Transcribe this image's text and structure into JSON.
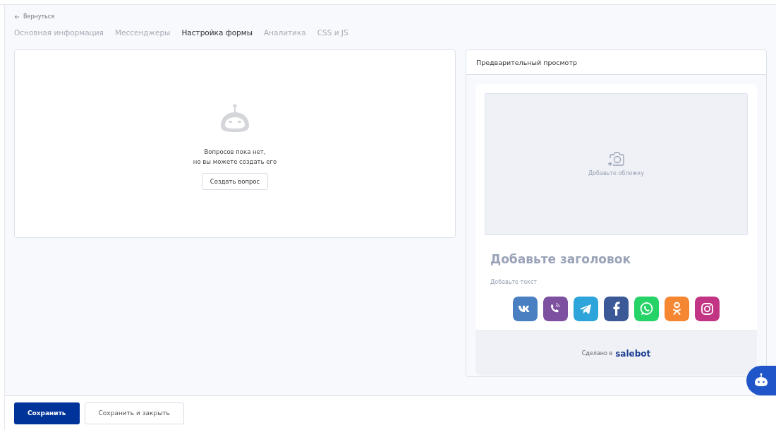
{
  "back_link": "Вернуться",
  "tabs": [
    {
      "label": "Основная информация",
      "selected": false
    },
    {
      "label": "Мессенджеры",
      "selected": false
    },
    {
      "label": "Настройка формы",
      "selected": true
    },
    {
      "label": "Аналитика",
      "selected": false
    },
    {
      "label": "CSS и JS",
      "selected": false
    }
  ],
  "questions": {
    "empty_text": [
      "Вопросов пока нет,",
      "но вы можете создать его"
    ],
    "create_button": "Создать вопрос"
  },
  "preview": {
    "title": "Предварительный просмотр",
    "cover_hint": "Добавьте обложку",
    "heading": "Добавьте заголовок",
    "text": "Добавьте текст",
    "messengers": [
      {
        "kind": "vk",
        "color": "#4a7fc1"
      },
      {
        "kind": "viber",
        "color": "#7d50a0"
      },
      {
        "kind": "telegram",
        "color": "#2ea5da"
      },
      {
        "kind": "facebook",
        "color": "#3b5897"
      },
      {
        "kind": "whatsapp",
        "color": "#25d366"
      },
      {
        "kind": "ok",
        "color": "#f58732"
      },
      {
        "kind": "instagram",
        "color": "#c13584"
      }
    ],
    "footer_text": "Сделано в",
    "footer_brand": "salebot"
  },
  "buttons": [
    {
      "label": "Сохранить",
      "kind": "primary"
    },
    {
      "label": "Сохранить и закрыть",
      "kind": "secondary"
    }
  ]
}
